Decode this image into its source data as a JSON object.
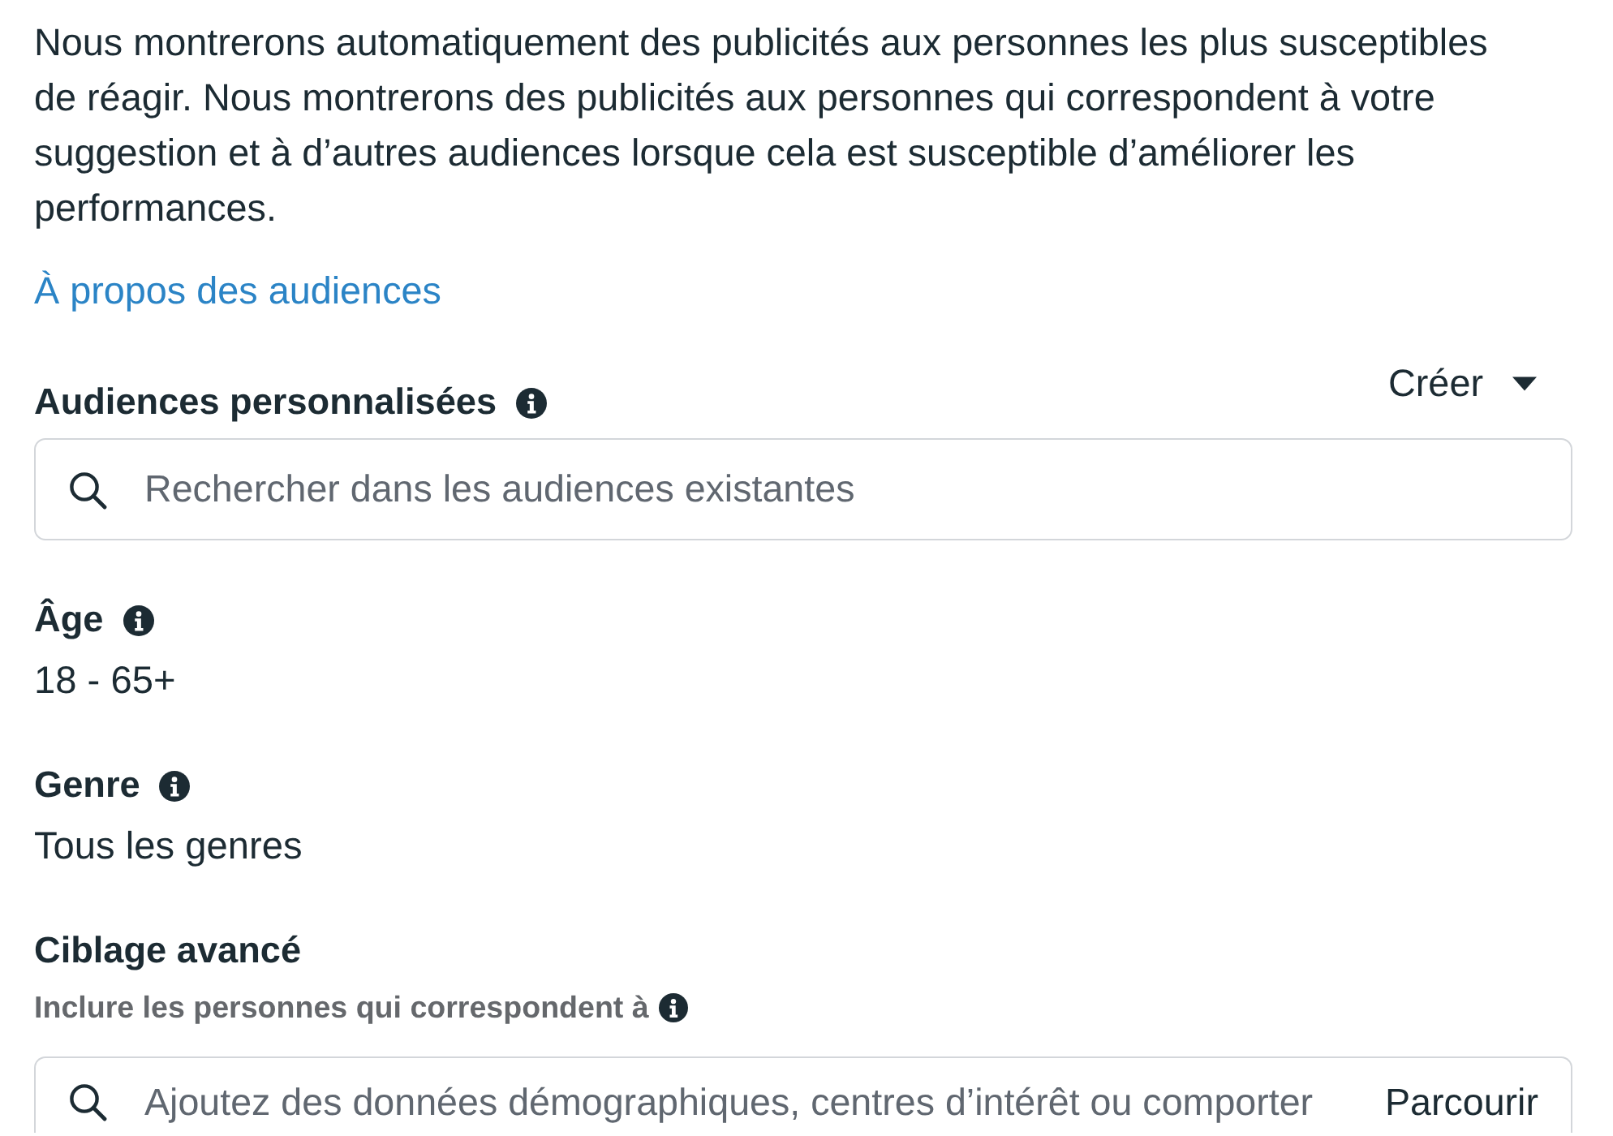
{
  "intro": {
    "text": "Nous montrerons automatiquement des publicités aux personnes les plus susceptibles de réagir. Nous montrerons des publicités aux personnes qui correspondent à votre suggestion et à d’autres audiences lorsque cela est susceptible d’améliorer les performances.",
    "link": "À propos des audiences"
  },
  "sections": [
    {
      "kind": "search",
      "label": "Audiences personnalisées",
      "info": true,
      "action": "Créer",
      "placeholder": "Rechercher dans les audiences existantes"
    },
    {
      "kind": "value",
      "label": "Âge",
      "info": true,
      "value": "18 - 65+"
    },
    {
      "kind": "value",
      "label": "Genre",
      "info": true,
      "value": "Tous les genres"
    },
    {
      "kind": "targeting",
      "label": "Ciblage avancé",
      "info": false,
      "note": "Inclure les personnes qui correspondent à",
      "note_info": true,
      "placeholder": "Ajoutez des données démographiques, centres d’intérêt ou comporter",
      "action": "Parcourir"
    }
  ]
}
